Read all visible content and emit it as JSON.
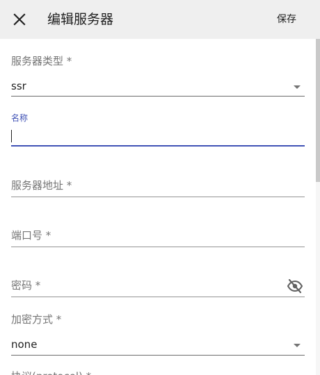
{
  "header": {
    "title": "编辑服务器",
    "save_label": "保存",
    "close_icon": "close-icon"
  },
  "fields": {
    "server_type": {
      "label": "服务器类型 *",
      "value": "ssr"
    },
    "name": {
      "label": "名称",
      "value": ""
    },
    "address": {
      "label": "服务器地址 *"
    },
    "port": {
      "label": "端口号 *"
    },
    "password": {
      "label": "密码 *",
      "icon": "eye-off-icon"
    },
    "method": {
      "label": "加密方式 *",
      "value": "none"
    },
    "protocol": {
      "label": "协议(protocol) *"
    }
  },
  "colors": {
    "accent": "#3f51b5",
    "appbar": "#efefef"
  }
}
